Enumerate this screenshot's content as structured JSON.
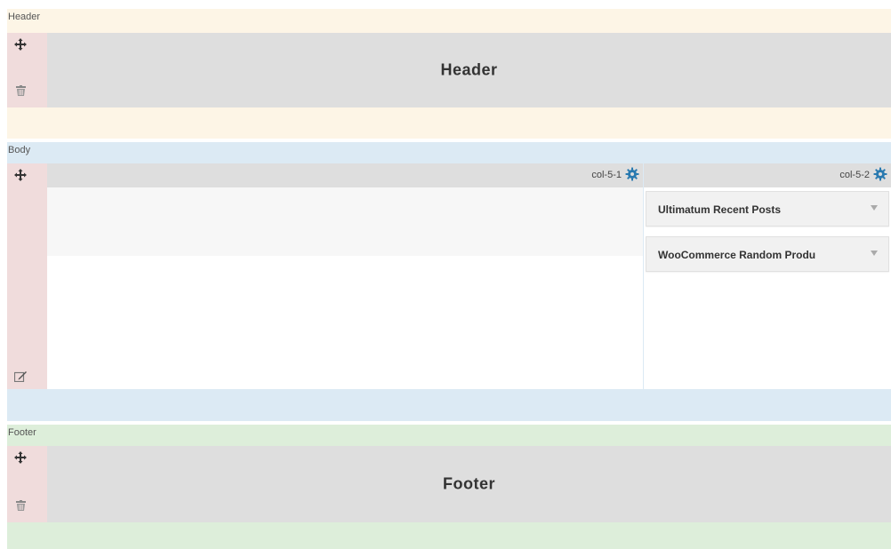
{
  "sections": {
    "header": {
      "label": "Header",
      "title": "Header"
    },
    "body": {
      "label": "Body",
      "columns": [
        {
          "name": "col-5-1",
          "widgets": []
        },
        {
          "name": "col-5-2",
          "widgets": [
            {
              "title": "Ultimatum Recent Posts"
            },
            {
              "title": "WooCommerce Random Produ"
            }
          ]
        }
      ]
    },
    "footer": {
      "label": "Footer",
      "title": "Footer"
    }
  },
  "icons": {
    "move": "move-icon",
    "delete": "trash-icon",
    "edit": "edit-icon",
    "settings": "gear-icon",
    "toggle": "caret-down-icon"
  },
  "colors": {
    "header_bg": "#fdf5e6",
    "body_bg": "#dceaf4",
    "footer_bg": "#ddeeda",
    "handle_bg": "#f0dcdc",
    "block_bg": "#dedede",
    "gear": "#2a7ab0"
  }
}
